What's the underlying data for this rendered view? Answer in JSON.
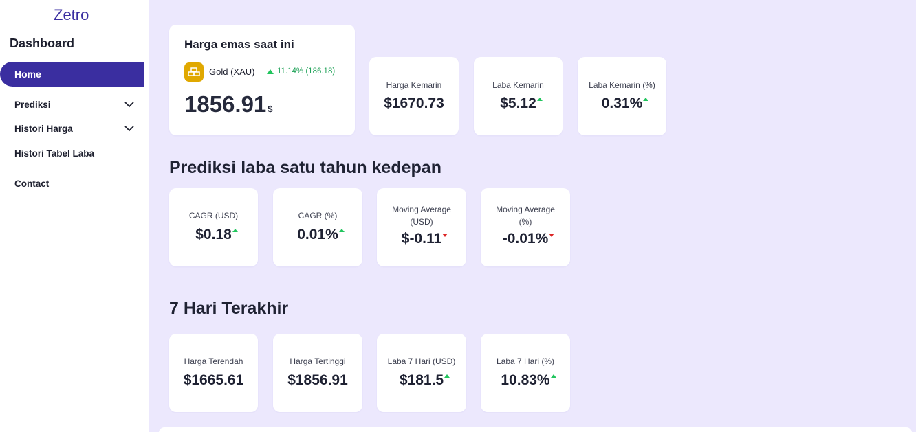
{
  "sidebar": {
    "brand": "Zetro",
    "section_title": "Dashboard",
    "items": [
      {
        "label": "Home",
        "active": true
      },
      {
        "label": "Prediksi",
        "has_chevron": true
      },
      {
        "label": "Histori Harga",
        "has_chevron": true
      },
      {
        "label": "Histori Tabel Laba",
        "has_chevron": false
      },
      {
        "label": "Contact",
        "has_chevron": false
      }
    ]
  },
  "current": {
    "title": "Harga emas saat ini",
    "asset_name": "Gold (XAU)",
    "change": "11.14% (186.18)",
    "price": "1856.91",
    "unit": "$",
    "icon": "gold-bars-icon"
  },
  "yesterday": [
    {
      "label": "Harga Kemarin",
      "value": "$1670.73",
      "trend": "none"
    },
    {
      "label": "Laba Kemarin",
      "value": "$5.12",
      "trend": "up"
    },
    {
      "label": "Laba Kemarin (%)",
      "value": "0.31%",
      "trend": "up"
    }
  ],
  "prediction": {
    "heading": "Prediksi laba satu tahun kedepan",
    "cards": [
      {
        "label": "CAGR (USD)",
        "value": "$0.18",
        "trend": "up"
      },
      {
        "label": "CAGR (%)",
        "value": "0.01%",
        "trend": "up"
      },
      {
        "label": "Moving Average (USD)",
        "value": "$-0.11",
        "trend": "down"
      },
      {
        "label": "Moving Average (%)",
        "value": "-0.01%",
        "trend": "down"
      }
    ]
  },
  "last7": {
    "heading": "7 Hari Terakhir",
    "cards": [
      {
        "label": "Harga Terendah",
        "value": "$1665.61",
        "trend": "none"
      },
      {
        "label": "Harga Tertinggi",
        "value": "$1856.91",
        "trend": "none"
      },
      {
        "label": "Laba 7 Hari (USD)",
        "value": "$181.5",
        "trend": "up"
      },
      {
        "label": "Laba 7 Hari (%)",
        "value": "10.83%",
        "trend": "up"
      }
    ]
  },
  "colors": {
    "accent": "#3a2ea0",
    "background": "#ece8fd",
    "up": "#22c55e",
    "down": "#dc2626",
    "gold": "#e0a800"
  }
}
